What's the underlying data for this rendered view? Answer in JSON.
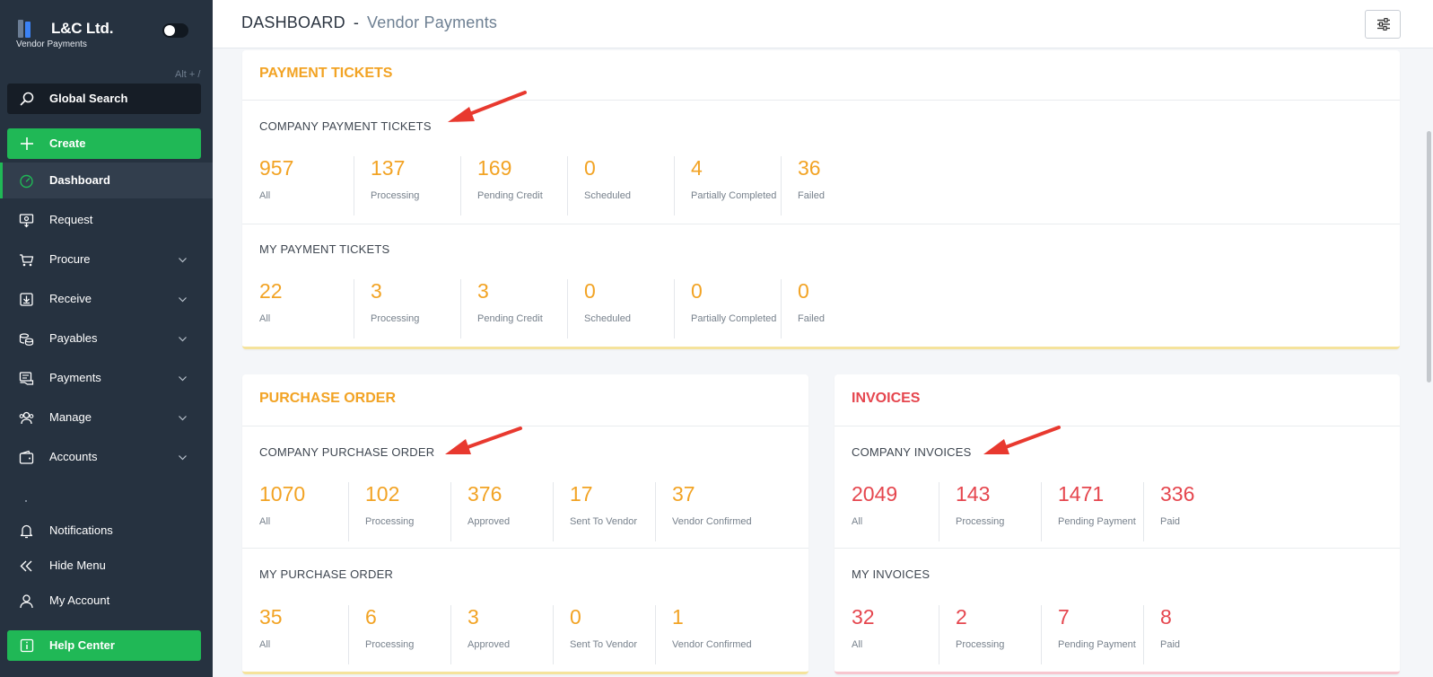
{
  "sidebar": {
    "brand_name": "L&C Ltd.",
    "brand_subtitle": "Vendor Payments",
    "search_shortcut": "Alt + /",
    "search_label": "Global Search",
    "create_label": "Create",
    "nav": [
      {
        "label": "Dashboard",
        "icon": "gauge-icon",
        "active": true
      },
      {
        "label": "Request",
        "icon": "request-icon"
      },
      {
        "label": "Procure",
        "icon": "cart-icon"
      },
      {
        "label": "Receive",
        "icon": "receive-icon"
      },
      {
        "label": "Payables",
        "icon": "coins-icon"
      },
      {
        "label": "Payments",
        "icon": "payments-icon"
      },
      {
        "label": "Manage",
        "icon": "users-icon"
      },
      {
        "label": "Accounts",
        "icon": "wallet-icon"
      }
    ],
    "bottom": [
      {
        "label": "Notifications",
        "icon": "bell-icon"
      },
      {
        "label": "Hide Menu",
        "icon": "double-chevron-left-icon"
      },
      {
        "label": "My Account",
        "icon": "user-icon"
      }
    ],
    "help_label": "Help Center"
  },
  "header": {
    "title": "DASHBOARD",
    "separator": "-",
    "subtitle": "Vendor Payments"
  },
  "payment_tickets": {
    "title": "PAYMENT TICKETS",
    "company": {
      "title": "COMPANY PAYMENT TICKETS",
      "stats": [
        {
          "value": "957",
          "label": "All"
        },
        {
          "value": "137",
          "label": "Processing"
        },
        {
          "value": "169",
          "label": "Pending Credit"
        },
        {
          "value": "0",
          "label": "Scheduled"
        },
        {
          "value": "4",
          "label": "Partially Completed"
        },
        {
          "value": "36",
          "label": "Failed"
        }
      ]
    },
    "mine": {
      "title": "MY PAYMENT TICKETS",
      "stats": [
        {
          "value": "22",
          "label": "All"
        },
        {
          "value": "3",
          "label": "Processing"
        },
        {
          "value": "3",
          "label": "Pending Credit"
        },
        {
          "value": "0",
          "label": "Scheduled"
        },
        {
          "value": "0",
          "label": "Partially Completed"
        },
        {
          "value": "0",
          "label": "Failed"
        }
      ]
    }
  },
  "purchase_order": {
    "title": "PURCHASE ORDER",
    "company": {
      "title": "COMPANY PURCHASE ORDER",
      "stats": [
        {
          "value": "1070",
          "label": "All"
        },
        {
          "value": "102",
          "label": "Processing"
        },
        {
          "value": "376",
          "label": "Approved"
        },
        {
          "value": "17",
          "label": "Sent To Vendor"
        },
        {
          "value": "37",
          "label": "Vendor Confirmed"
        }
      ]
    },
    "mine": {
      "title": "MY PURCHASE ORDER",
      "stats": [
        {
          "value": "35",
          "label": "All"
        },
        {
          "value": "6",
          "label": "Processing"
        },
        {
          "value": "3",
          "label": "Approved"
        },
        {
          "value": "0",
          "label": "Sent To Vendor"
        },
        {
          "value": "1",
          "label": "Vendor Confirmed"
        }
      ]
    }
  },
  "invoices": {
    "title": "INVOICES",
    "company": {
      "title": "COMPANY INVOICES",
      "stats": [
        {
          "value": "2049",
          "label": "All"
        },
        {
          "value": "143",
          "label": "Processing"
        },
        {
          "value": "1471",
          "label": "Pending Payment"
        },
        {
          "value": "336",
          "label": "Paid"
        }
      ]
    },
    "mine": {
      "title": "MY INVOICES",
      "stats": [
        {
          "value": "32",
          "label": "All"
        },
        {
          "value": "2",
          "label": "Processing"
        },
        {
          "value": "7",
          "label": "Pending Payment"
        },
        {
          "value": "8",
          "label": "Paid"
        }
      ]
    }
  },
  "colors": {
    "accent_orange": "#f2a324",
    "accent_red": "#e5464e",
    "brand_green": "#20b856",
    "sidebar_bg": "#263240",
    "annotation_arrow": "#e8392f"
  }
}
